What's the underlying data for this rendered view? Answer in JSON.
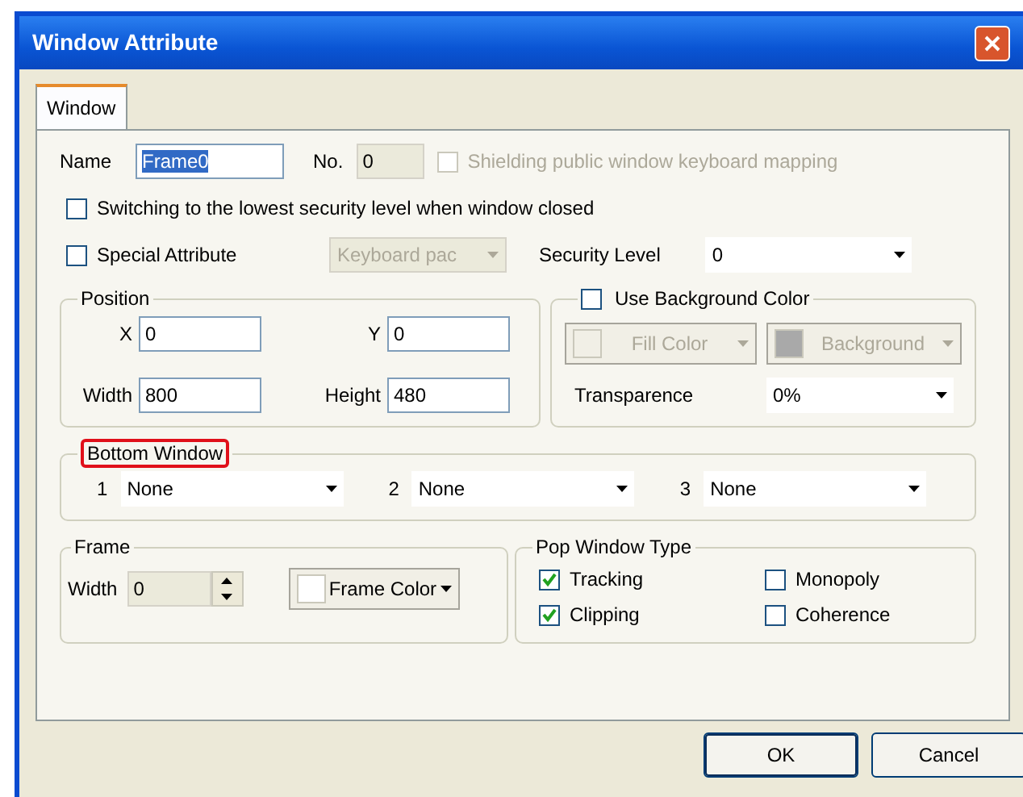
{
  "window": {
    "title": "Window Attribute"
  },
  "tabs": [
    {
      "label": "Window",
      "selected": true
    }
  ],
  "name_field": {
    "label": "Name",
    "value": "Frame0",
    "highlighted": true
  },
  "number_field": {
    "label": "No.",
    "value": "0",
    "disabled": true
  },
  "shielding": {
    "label": "Shielding public window keyboard mapping",
    "checked": false,
    "disabled": true
  },
  "switching": {
    "label": "Switching to the lowest security level when window closed",
    "checked": false,
    "disabled": false
  },
  "special_attribute": {
    "label": "Special Attribute",
    "checked": false,
    "disabled": false
  },
  "keyboard_dropdown": {
    "value": "Keyboard pac",
    "disabled": true
  },
  "security_level": {
    "label": "Security Level",
    "value": "0"
  },
  "position": {
    "title": "Position",
    "fields": [
      {
        "label": "X",
        "value": "0"
      },
      {
        "label": "Y",
        "value": "0"
      },
      {
        "label": "Width",
        "value": "800"
      },
      {
        "label": "Height",
        "value": "480"
      }
    ]
  },
  "background": {
    "title": "Use Background Color",
    "checked": false,
    "fill_color": {
      "label": "Fill Color",
      "disabled": true
    },
    "background_button": {
      "label": "Background",
      "disabled": true
    },
    "transparence": {
      "label": "Transparence",
      "value": "0%"
    }
  },
  "bottom_window": {
    "title": "Bottom Window",
    "highlighted": true,
    "slots": [
      {
        "label": "1",
        "value": "None"
      },
      {
        "label": "2",
        "value": "None"
      },
      {
        "label": "3",
        "value": "None"
      }
    ]
  },
  "frame": {
    "title": "Frame",
    "width": {
      "label": "Width",
      "value": "0"
    },
    "color_button": {
      "label": "Frame Color"
    }
  },
  "pop_window_type": {
    "title": "Pop Window Type",
    "options": [
      {
        "label": "Tracking",
        "checked": true
      },
      {
        "label": "Monopoly",
        "checked": false
      },
      {
        "label": "Clipping",
        "checked": true
      },
      {
        "label": "Coherence",
        "checked": false
      }
    ]
  },
  "buttons": [
    {
      "label": "OK",
      "default": true
    },
    {
      "label": "Cancel",
      "default": false
    }
  ]
}
